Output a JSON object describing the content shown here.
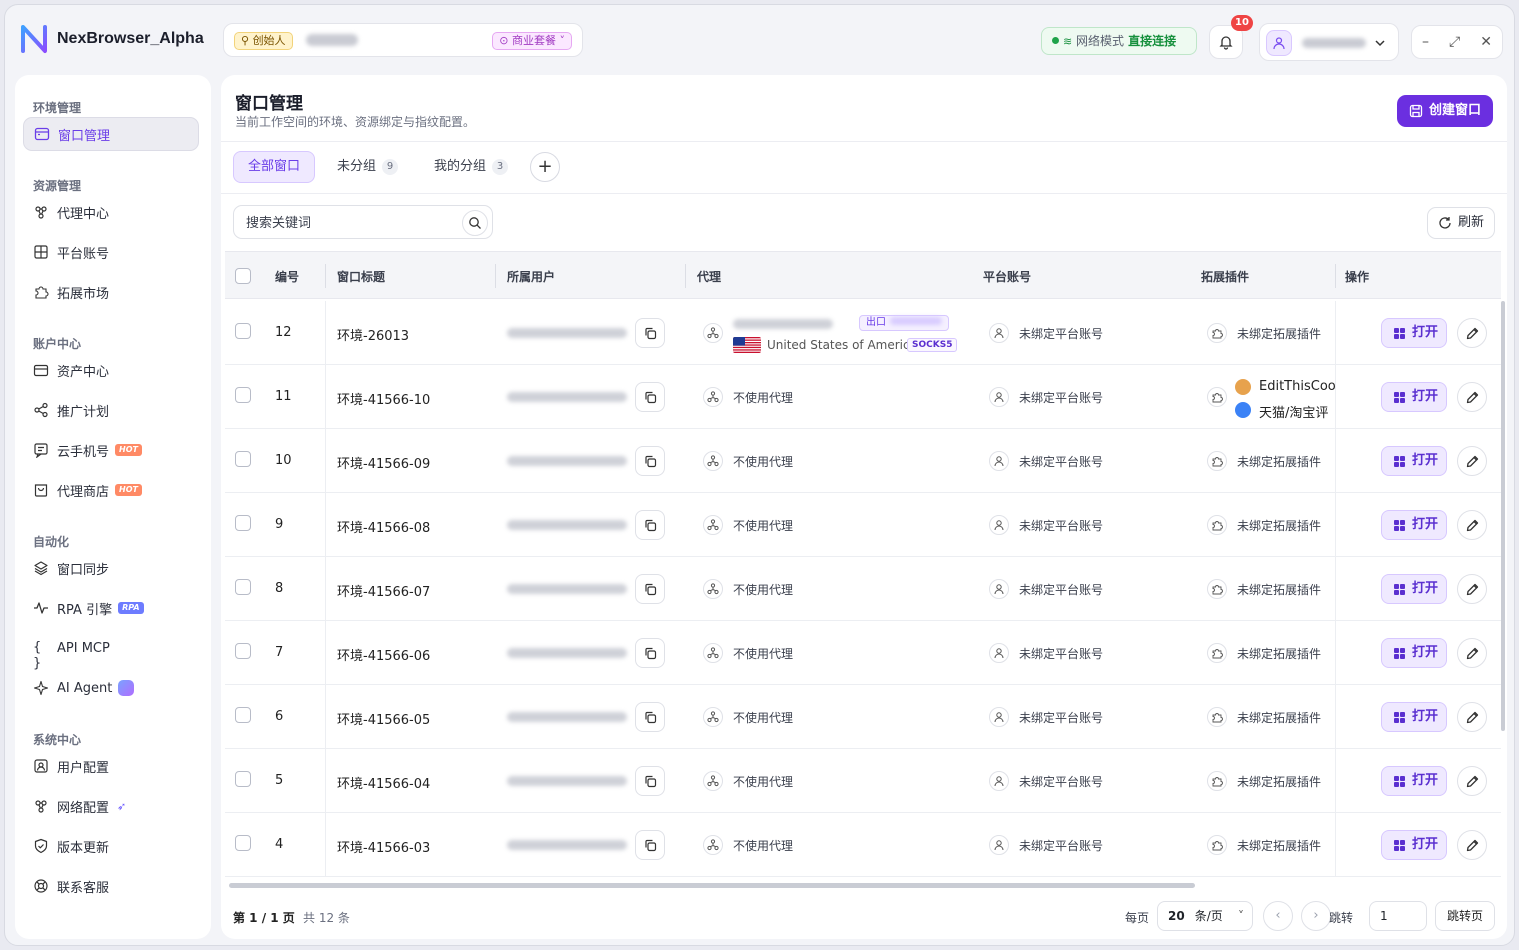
{
  "app": {
    "name": "NexBrowser_Alpha"
  },
  "header": {
    "founder_badge": "创始人",
    "plan_badge": "商业套餐",
    "net_label": "网络模式",
    "net_value": "直接连接",
    "notification_count": "10"
  },
  "sidebar": {
    "sections": [
      {
        "title": "环境管理",
        "items": [
          {
            "label": "窗口管理",
            "icon": "window-icon",
            "active": true
          }
        ]
      },
      {
        "title": "资源管理",
        "items": [
          {
            "label": "代理中心",
            "icon": "proxy-icon"
          },
          {
            "label": "平台账号",
            "icon": "grid-icon"
          },
          {
            "label": "拓展市场",
            "icon": "puzzle-icon"
          }
        ]
      },
      {
        "title": "账户中心",
        "items": [
          {
            "label": "资产中心",
            "icon": "wallet-icon"
          },
          {
            "label": "推广计划",
            "icon": "share-icon"
          },
          {
            "label": "云手机号",
            "icon": "message-icon",
            "tag": "HOT"
          },
          {
            "label": "代理商店",
            "icon": "store-icon",
            "tag": "HOT"
          }
        ]
      },
      {
        "title": "自动化",
        "items": [
          {
            "label": "窗口同步",
            "icon": "layers-icon"
          },
          {
            "label": "RPA 引擎",
            "icon": "pulse-icon",
            "tag": "RPA"
          },
          {
            "label": "API MCP",
            "icon": "braces-icon"
          },
          {
            "label": "AI Agent",
            "icon": "sparkle-icon"
          }
        ]
      },
      {
        "title": "系统中心",
        "items": [
          {
            "label": "用户配置",
            "icon": "user-config-icon"
          },
          {
            "label": "网络配置",
            "icon": "network-icon"
          },
          {
            "label": "版本更新",
            "icon": "shield-icon"
          },
          {
            "label": "联系客服",
            "icon": "support-icon"
          }
        ]
      }
    ]
  },
  "page": {
    "title": "窗口管理",
    "subtitle": "当前工作空间的环境、资源绑定与指纹配置。",
    "create_button": "创建窗口",
    "tabs": [
      {
        "label": "全部窗口",
        "count": "",
        "active": true
      },
      {
        "label": "未分组",
        "count": "9"
      },
      {
        "label": "我的分组",
        "count": "3"
      }
    ],
    "search_placeholder": "搜索关键词",
    "refresh_button": "刷新"
  },
  "table": {
    "columns": [
      "编号",
      "窗口标题",
      "所属用户",
      "代理",
      "平台账号",
      "拓展插件",
      "操作"
    ],
    "rows": [
      {
        "no": "12",
        "title": "环境-26013",
        "proxy": "",
        "proxy_out": "出口",
        "proxy_country": "United States of Americ...",
        "proxy_type": "SOCKS5",
        "account": "未绑定平台账号",
        "ext": "未绑定拓展插件"
      },
      {
        "no": "11",
        "title": "环境-41566-10",
        "proxy": "不使用代理",
        "account": "未绑定平台账号",
        "ext": "",
        "ext_list": [
          "EditThisCoo",
          "天猫/淘宝评"
        ]
      },
      {
        "no": "10",
        "title": "环境-41566-09",
        "proxy": "不使用代理",
        "account": "未绑定平台账号",
        "ext": "未绑定拓展插件"
      },
      {
        "no": "9",
        "title": "环境-41566-08",
        "proxy": "不使用代理",
        "account": "未绑定平台账号",
        "ext": "未绑定拓展插件"
      },
      {
        "no": "8",
        "title": "环境-41566-07",
        "proxy": "不使用代理",
        "account": "未绑定平台账号",
        "ext": "未绑定拓展插件"
      },
      {
        "no": "7",
        "title": "环境-41566-06",
        "proxy": "不使用代理",
        "account": "未绑定平台账号",
        "ext": "未绑定拓展插件"
      },
      {
        "no": "6",
        "title": "环境-41566-05",
        "proxy": "不使用代理",
        "account": "未绑定平台账号",
        "ext": "未绑定拓展插件"
      },
      {
        "no": "5",
        "title": "环境-41566-04",
        "proxy": "不使用代理",
        "account": "未绑定平台账号",
        "ext": "未绑定拓展插件"
      },
      {
        "no": "4",
        "title": "环境-41566-03",
        "proxy": "不使用代理",
        "account": "未绑定平台账号",
        "ext": "未绑定拓展插件"
      }
    ],
    "open_label": "打开"
  },
  "footer": {
    "page_info": "第 1 / 1 页",
    "total": "共 12 条",
    "per_page_label": "每页",
    "per_page_value": "20",
    "per_page_unit": "条/页",
    "jump_label": "跳转",
    "jump_value": "1",
    "jump_button": "跳转页"
  },
  "colors": {
    "accent": "#6b2fe0",
    "success": "#16903d",
    "danger": "#ef4444"
  }
}
